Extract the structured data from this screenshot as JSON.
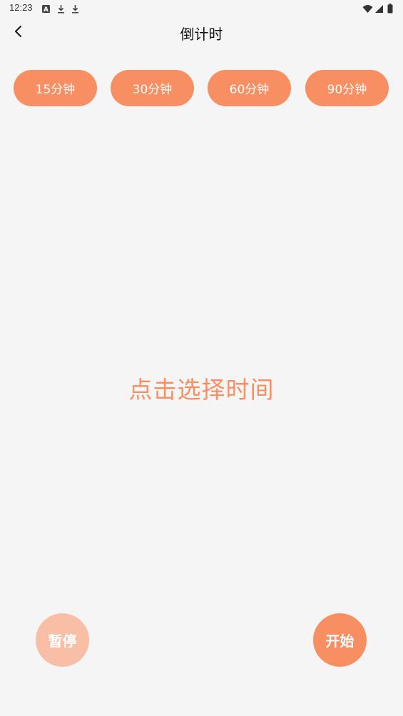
{
  "status_bar": {
    "time": "12:23",
    "icons": [
      "a-notification-icon",
      "download-icon",
      "download-icon",
      "wifi-icon",
      "signal-icon",
      "battery-icon"
    ]
  },
  "app_bar": {
    "title": "倒计时",
    "back_icon": "chevron-left-icon"
  },
  "presets": [
    {
      "label": "15分钟"
    },
    {
      "label": "30分钟"
    },
    {
      "label": "60分钟"
    },
    {
      "label": "90分钟"
    }
  ],
  "prompt": "点击选择时间",
  "controls": {
    "pause_label": "暂停",
    "start_label": "开始"
  },
  "colors": {
    "accent": "#f88f62",
    "accent_light": "#f8bea6",
    "background": "#f5f5f5"
  }
}
